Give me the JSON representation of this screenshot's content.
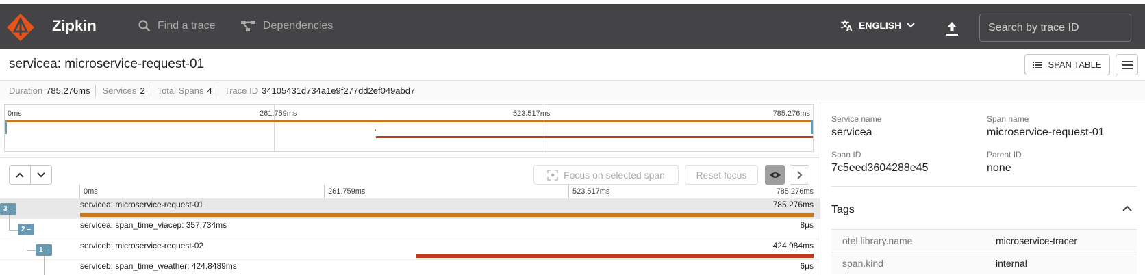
{
  "header": {
    "brand": "Zipkin",
    "nav": [
      {
        "label": "Find a trace",
        "icon": "search-icon"
      },
      {
        "label": "Dependencies",
        "icon": "dependencies-icon"
      }
    ],
    "language": "ENGLISH",
    "search_placeholder": "Search by trace ID",
    "colors": {
      "bar_bg": "#444446",
      "logo": "#e6541b"
    }
  },
  "title": "servicea: microservice-request-01",
  "actions": {
    "span_table": "SPAN TABLE"
  },
  "summary": [
    {
      "label": "Duration",
      "value": "785.276ms"
    },
    {
      "label": "Services",
      "value": "2"
    },
    {
      "label": "Total Spans",
      "value": "4"
    },
    {
      "label": "Trace ID",
      "value": "34105431d734a1e9f277dd2ef049abd7"
    }
  ],
  "minimap": {
    "ticks": [
      "0ms",
      "261.759ms",
      "523.517ms",
      "785.276ms"
    ]
  },
  "toolbar": {
    "focus_label": "Focus on selected span",
    "reset_label": "Reset focus"
  },
  "timeline": {
    "ticks": [
      "0ms",
      "261.759ms",
      "523.517ms",
      "785.276ms"
    ],
    "total_ms": 785.276,
    "spans": [
      {
        "label": "servicea: microservice-request-01",
        "duration": "785.276ms",
        "badge": "3 –",
        "start_ms": 0,
        "duration_ms": 785.276,
        "color": "#c77a1c",
        "selected": true
      },
      {
        "label": "servicea: span_time_viacep: 357.734ms",
        "duration": "8μs",
        "badge": "2 –",
        "start_ms": 0,
        "duration_ms": 0,
        "color": "#c77a1c",
        "selected": false
      },
      {
        "label": "serviceb: microservice-request-02",
        "duration": "424.984ms",
        "badge": "1 –",
        "start_ms": 360.3,
        "duration_ms": 424.984,
        "color": "#c0391b",
        "selected": false
      },
      {
        "label": "serviceb: span_time_weather: 424.8489ms",
        "duration": "6μs",
        "badge": "",
        "start_ms": 785.27,
        "duration_ms": 0,
        "color": "#c0391b",
        "selected": false
      }
    ]
  },
  "details": {
    "service_name_label": "Service name",
    "service_name": "servicea",
    "span_name_label": "Span name",
    "span_name": "microservice-request-01",
    "span_id_label": "Span ID",
    "span_id": "7c5eed3604288e45",
    "parent_id_label": "Parent ID",
    "parent_id": "none",
    "tags_title": "Tags",
    "tags": [
      {
        "key": "otel.library.name",
        "value": "microservice-tracer"
      },
      {
        "key": "span.kind",
        "value": "internal"
      }
    ]
  }
}
